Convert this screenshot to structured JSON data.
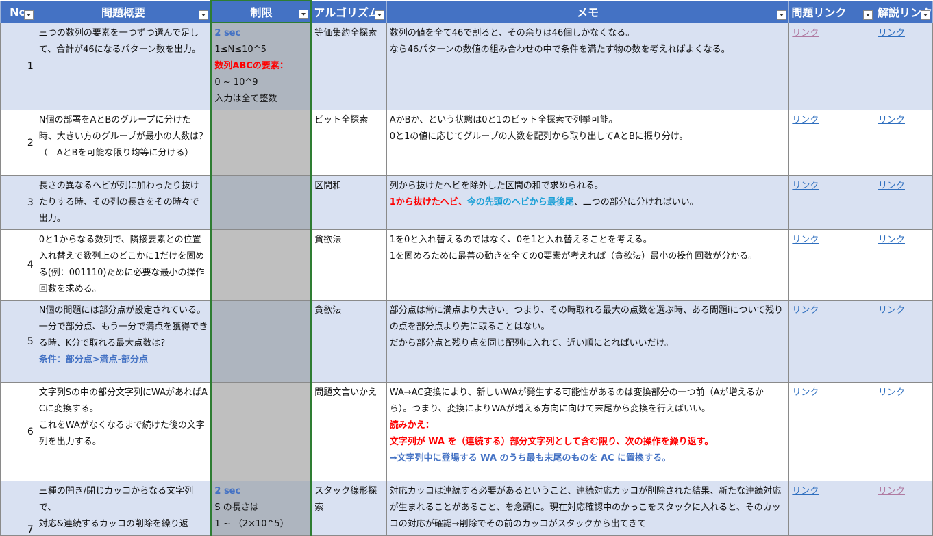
{
  "headers": {
    "no": "No",
    "summary": "問題概要",
    "limit": "制限",
    "algo": "アルゴリズム",
    "memo": "メモ",
    "problem_link": "問題リンク",
    "editorial_link": "解説リンク"
  },
  "link_text": "リンク",
  "rows": [
    {
      "no": "1",
      "summary": [
        "三つの数列の要素を一つずつ選んで足して、合計が46になるパターン数を出力。"
      ],
      "limit": [
        "2 sec",
        "1≤N≤10^5",
        "数列ABCの要素：",
        "0 ~ 10^9",
        "入力は全て整数"
      ],
      "algo": "等価集約全探索",
      "memo": [
        "数列の値を全て46で割ると、その余りは46個しかなくなる。",
        "なら46パターンの数値の組み合わせの中で条件を満たす物の数を考えればよくなる。"
      ]
    },
    {
      "no": "2",
      "summary": [
        "N個の部署をAとBのグループに分けた時、大きい方のグループが最小の人数は？（＝AとBを可能な限り均等に分ける）"
      ],
      "limit": [],
      "algo": "ビット全探索",
      "memo": [
        "AかBか、という状態は0と1のビット全探索で列挙可能。",
        "0と1の値に応じてグループの人数を配列から取り出してAとBに振り分け。"
      ]
    },
    {
      "no": "3",
      "summary": [
        "長さの異なるヘビが列に加わったり抜けたりする時、その列の長さをその時々で出力。"
      ],
      "limit": [],
      "algo": "区間和",
      "memo": [
        "列から抜けたヘビを除外した区間の和で求められる。"
      ],
      "memo_colored": {
        "red": "1から抜けたヘビ、",
        "blue": "今の先頭のヘビから最後尾",
        "rest": "、二つの部分に分ければいい。"
      }
    },
    {
      "no": "4",
      "summary": [
        "0と1からなる数列で、隣接要素との位置入れ替えで数列上のどこかに1だけを固める(例：001110)ために必要な最小の操作回数を求める。"
      ],
      "limit": [],
      "algo": "貪欲法",
      "memo": [
        "1を0と入れ替えるのではなく、0を1と入れ替えることを考える。",
        "1を固めるために最善の動きを全ての0要素が考えれば（貪欲法）最小の操作回数が分かる。"
      ]
    },
    {
      "no": "5",
      "summary": [
        "N個の問題には部分点が設定されている。一分で部分点、もう一分で満点を獲得できる時、K分で取れる最大点数は？"
      ],
      "summary_note": "条件：部分点>満点-部分点",
      "limit": [],
      "algo": "貪欲法",
      "memo": [
        "部分点は常に満点より大きい。つまり、その時取れる最大の点数を選ぶ時、ある問題iについて残りの点を部分点より先に取ることはない。",
        "だから部分点と残り点を同じ配列に入れて、近い順にとればいいだけ。"
      ]
    },
    {
      "no": "6",
      "summary": [
        "文字列Sの中の部分文字列にWAがあればACに変換する。",
        "これをWAがなくなるまで続けた後の文字列を出力する。"
      ],
      "limit": [],
      "algo": "問題文言いかえ",
      "memo": [
        "WA→AC変換により、新しいWAが発生する可能性があるのは変換部分の一つ前（Aが増えるから）。つまり、変換によりWAが増える方向に向けて末尾から変換を行えばいい。"
      ],
      "memo_extra": {
        "red1": "読みかえ：",
        "red2": "文字列が WA を（連続する）部分文字列として含む限り、次の操作を繰り返す。",
        "blue": "→文字列中に登場する WA のうち最も末尾のものを AC に置換する。"
      }
    },
    {
      "no": "7",
      "summary": [
        "三種の開き/閉じカッコからなる文字列で、",
        "対応&連続するカッコの削除を繰り返"
      ],
      "limit": [
        "2 sec",
        "S の長さは",
        "1 ~ （2×10^5）"
      ],
      "algo": "スタック線形探索",
      "memo": [
        "対応カッコは連続する必要があるということ、連続対応カッコが削除された結果、新たな連続対応が生まれることがあること、を念頭に。現在対応確認中のかっこをスタックに入れると、そのカッコの対応が確認→削除でその前のカッコがスタックから出てきて"
      ]
    }
  ],
  "colors": {
    "header_bg": "#4472c4",
    "odd_row": "#d9e1f2",
    "limit_col": "#aeb5bf",
    "red_text": "#ff0000",
    "cyan_text": "#1a9fd6"
  }
}
